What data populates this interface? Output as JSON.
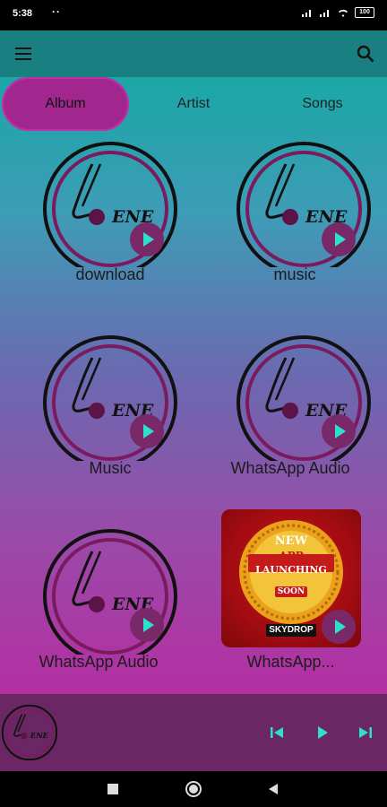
{
  "status": {
    "time": "5:38",
    "dots": "··",
    "battery": "100"
  },
  "tabs": [
    {
      "label": "Album"
    },
    {
      "label": "Artist"
    },
    {
      "label": "Songs"
    }
  ],
  "albums": [
    {
      "label": "download"
    },
    {
      "label": "music"
    },
    {
      "label": "Music"
    },
    {
      "label": "WhatsApp Audio"
    },
    {
      "label": "WhatsApp Audio"
    },
    {
      "label": "WhatsApp..."
    }
  ],
  "poster": {
    "line1": "NEW",
    "line2": "APP",
    "line3": "LAUNCHING",
    "line4": "SOON",
    "brand": "SKYDROP"
  },
  "logo": {
    "text": "ENE"
  },
  "colors": {
    "accent": "#a1278f",
    "appbar": "#1a7f80",
    "player": "#6b2763",
    "play_button": "#7a2968",
    "play_icon": "#2ee0c8"
  }
}
